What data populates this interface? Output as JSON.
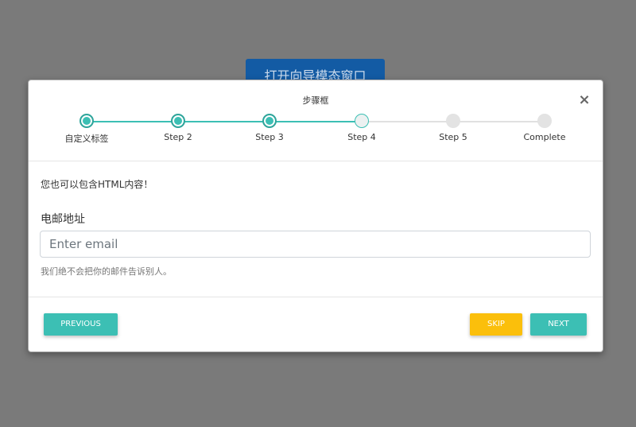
{
  "background": {
    "open_button_label": "打开向导模态窗口"
  },
  "modal": {
    "title": "步骤框",
    "close_symbol": "×",
    "steps": [
      {
        "label": "自定义标签",
        "state": "done"
      },
      {
        "label": "Step 2",
        "state": "done"
      },
      {
        "label": "Step 3",
        "state": "done"
      },
      {
        "label": "Step 4",
        "state": "current"
      },
      {
        "label": "Step 5",
        "state": "todo"
      },
      {
        "label": "Complete",
        "state": "todo"
      }
    ],
    "body": {
      "intro": "您也可以包含HTML内容！",
      "email_label": "电邮地址",
      "email_value": "",
      "email_placeholder": "Enter email",
      "help_text": "我们绝不会把你的邮件告诉别人。"
    },
    "footer": {
      "previous_label": "PREVIOUS",
      "skip_label": "SKIP",
      "next_label": "NEXT"
    }
  },
  "colors": {
    "accent": "#3cbfb4",
    "skip": "#fbbf0b",
    "open_button": "#0e5aa7",
    "overlay": "#7a7a7a"
  }
}
